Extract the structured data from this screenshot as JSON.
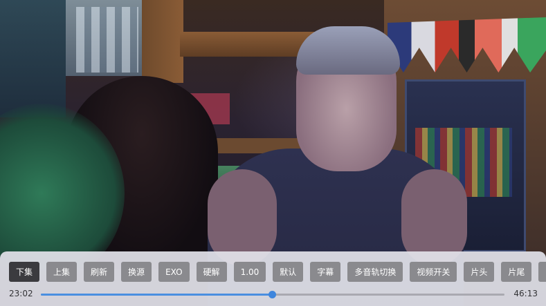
{
  "player": {
    "buttons": [
      {
        "label": "下集",
        "active": true
      },
      {
        "label": "上集"
      },
      {
        "label": "刷新"
      },
      {
        "label": "换源"
      },
      {
        "label": "EXO"
      },
      {
        "label": "硬解"
      },
      {
        "label": "1.00"
      },
      {
        "label": "默认"
      },
      {
        "label": "字幕"
      },
      {
        "label": "多音轨切换"
      },
      {
        "label": "视频开关"
      },
      {
        "label": "片头"
      },
      {
        "label": "片尾"
      },
      {
        "label": "倍"
      }
    ],
    "current_time": "23:02",
    "total_time": "46:13",
    "progress_fraction": 0.4983,
    "accent_color": "#4a8fe0"
  }
}
